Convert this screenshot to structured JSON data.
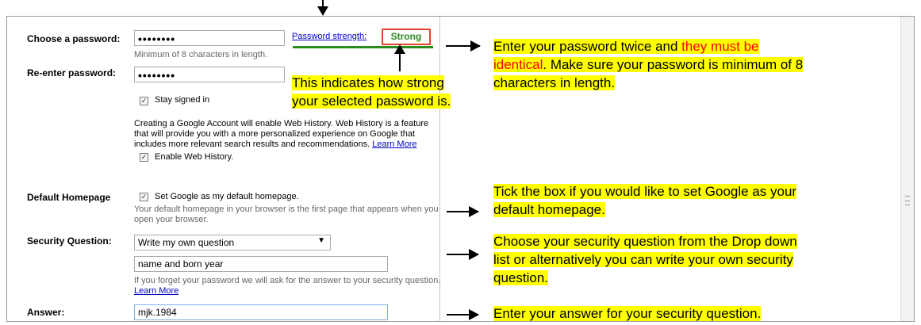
{
  "form": {
    "choose_password_label": "Choose a password:",
    "password_value": "••••••••",
    "password_hint": "Minimum of 8 characters in length.",
    "strength_link": "Password strength:",
    "strength_value": "Strong",
    "reenter_label": "Re-enter password:",
    "reenter_value": "••••••••",
    "stay_signed_in": "Stay signed in",
    "web_history_text": "Creating a Google Account will enable Web History. Web History is a feature that will provide you with a more personalized experience on Google that includes more relevant search results and recommendations.",
    "learn_more": "Learn More",
    "enable_web_history": "Enable Web History.",
    "default_homepage_label": "Default Homepage",
    "set_homepage": "Set Google as my default homepage.",
    "homepage_hint": "Your default homepage in your browser is the first page that appears when you open your browser.",
    "security_question_label": "Security Question:",
    "security_question_selected": "Write my own question",
    "security_question_custom": "name and born year",
    "security_hint": "If you forget your password we will ask for the answer to your security question.",
    "security_learn_more": "Learn More",
    "answer_label": "Answer:",
    "answer_value": "mjk.1984"
  },
  "annotations": {
    "strength_note_1": "This indicates how strong",
    "strength_note_2": "your selected password is.",
    "password_note_a": "Enter your password twice and ",
    "password_note_red": "they must be",
    "password_note_b": "identical",
    "password_note_c": ". Make sure your password is minimum of 8",
    "password_note_d": "characters in length.",
    "homepage_note_1": "Tick the box if you would like to set Google as your",
    "homepage_note_2": "default homepage.",
    "security_note_1": "Choose your security question from the Drop down",
    "security_note_2": "list or alternatively you can write your own security",
    "security_note_3": "question.",
    "answer_note": "Enter your answer for your security question."
  },
  "colors": {
    "strength_green": "#2c8a1f",
    "strong_border": "#e0442b",
    "highlight": "#ffff00",
    "link": "#0000cc"
  }
}
